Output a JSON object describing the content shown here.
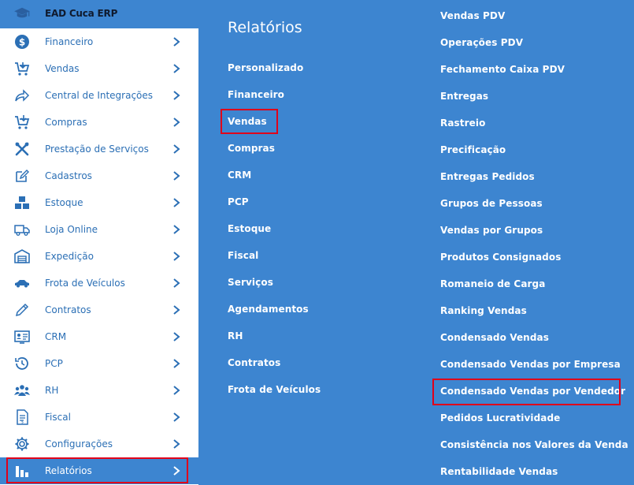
{
  "brand": {
    "label": "EAD Cuca ERP",
    "icon": "graduation-cap-icon"
  },
  "sidebar": {
    "items": [
      {
        "label": "Financeiro",
        "icon": "dollar-coin-icon"
      },
      {
        "label": "Vendas",
        "icon": "cart-plus-icon"
      },
      {
        "label": "Central de Integrações",
        "icon": "share-arrow-icon"
      },
      {
        "label": "Compras",
        "icon": "cart-down-icon"
      },
      {
        "label": "Prestação de Serviços",
        "icon": "tools-icon"
      },
      {
        "label": "Cadastros",
        "icon": "edit-icon"
      },
      {
        "label": "Estoque",
        "icon": "boxes-icon"
      },
      {
        "label": "Loja Online",
        "icon": "truck-icon"
      },
      {
        "label": "Expedição",
        "icon": "warehouse-icon"
      },
      {
        "label": "Frota de Veículos",
        "icon": "car-icon"
      },
      {
        "label": "Contratos",
        "icon": "pen-icon"
      },
      {
        "label": "CRM",
        "icon": "id-card-icon"
      },
      {
        "label": "PCP",
        "icon": "clock-history-icon"
      },
      {
        "label": "RH",
        "icon": "users-icon"
      },
      {
        "label": "Fiscal",
        "icon": "document-icon"
      },
      {
        "label": "Configurações",
        "icon": "gear-icon"
      },
      {
        "label": "Relatórios",
        "icon": "bar-chart-icon"
      }
    ]
  },
  "panel": {
    "title": "Relatórios",
    "categories": [
      "Personalizado",
      "Financeiro",
      "Vendas",
      "Compras",
      "CRM",
      "PCP",
      "Estoque",
      "Fiscal",
      "Serviços",
      "Agendamentos",
      "RH",
      "Contratos",
      "Frota de Veículos"
    ],
    "reports": [
      "Vendas PDV",
      "Operações PDV",
      "Fechamento Caixa PDV",
      "Entregas",
      "Rastreio",
      "Precificação",
      "Entregas Pedidos",
      "Grupos de Pessoas",
      "Vendas por Grupos",
      "Produtos Consignados",
      "Romaneio de Carga",
      "Ranking Vendas",
      "Condensado Vendas",
      "Condensado Vendas por Empresa",
      "Condensado Vendas por Vendedor",
      "Pedidos Lucratividade",
      "Consistência nos Valores da Venda",
      "Rentabilidade Vendas"
    ]
  },
  "colors": {
    "accent": "#3d85d0",
    "highlight": "#e0001a",
    "menu_text": "#2b6fb5"
  }
}
